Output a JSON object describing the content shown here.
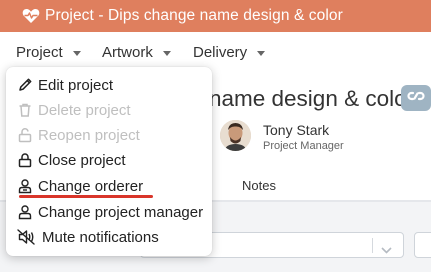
{
  "window": {
    "title": "Project - Dips change name design & color",
    "icon": "heart-pulse-icon"
  },
  "nav": {
    "items": [
      {
        "label": "Project",
        "icon": "caret-down-icon"
      },
      {
        "label": "Artwork",
        "icon": "caret-down-icon"
      },
      {
        "label": "Delivery",
        "icon": "caret-down-icon"
      }
    ]
  },
  "project": {
    "title_visible": "name design & color",
    "link_icon": "link-icon",
    "manager": {
      "name": "Tony Stark",
      "role": "Project Manager"
    }
  },
  "tabs": {
    "notes": "Notes"
  },
  "menu": {
    "items": [
      {
        "label": "Edit project",
        "icon": "pencil-icon",
        "enabled": true
      },
      {
        "label": "Delete project",
        "icon": "trash-icon",
        "enabled": false
      },
      {
        "label": "Reopen project",
        "icon": "unlock-icon",
        "enabled": false
      },
      {
        "label": "Close project",
        "icon": "lock-icon",
        "enabled": true
      },
      {
        "label": "Change orderer",
        "icon": "user-id-icon",
        "enabled": true,
        "highlighted": true
      },
      {
        "label": "Change project manager",
        "icon": "user-icon",
        "enabled": true
      },
      {
        "label": "Mute notifications",
        "icon": "bell-slash-icon",
        "enabled": true
      }
    ]
  },
  "colors": {
    "titlebar": "#df7f5e",
    "highlight_underline": "#d9352a",
    "link_button": "#9fb4c3",
    "disabled_text": "#bfbfbf"
  }
}
